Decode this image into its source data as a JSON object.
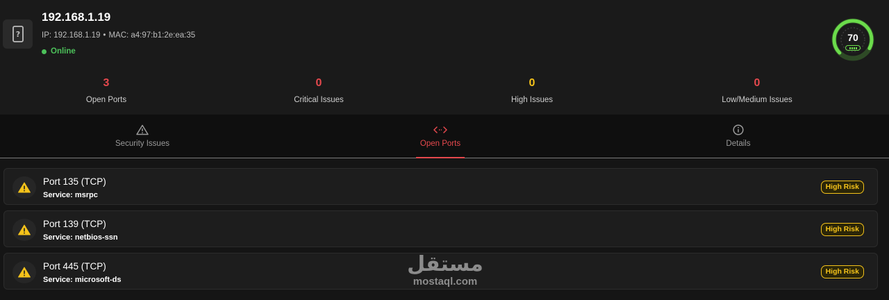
{
  "device": {
    "title": "192.168.1.19",
    "ip_line": "IP: 192.168.1.19",
    "separator": "•",
    "mac_line": "MAC: a4:97:b1:2e:ea:35",
    "status": "Online",
    "score": "70",
    "icon": "unknown-device-icon"
  },
  "stats": [
    {
      "value": "3",
      "label": "Open Ports",
      "color": "#e5484d"
    },
    {
      "value": "0",
      "label": "Critical Issues",
      "color": "#e5484d"
    },
    {
      "value": "0",
      "label": "High Issues",
      "color": "#f4c21a"
    },
    {
      "value": "0",
      "label": "Low/Medium Issues",
      "color": "#e5484d"
    }
  ],
  "tabs": [
    {
      "label": "Security Issues",
      "icon": "warning-triangle-icon"
    },
    {
      "label": "Open Ports",
      "icon": "code-arrows-icon",
      "active": true
    },
    {
      "label": "Details",
      "icon": "info-circle-icon"
    }
  ],
  "ports": [
    {
      "title": "Port 135 (TCP)",
      "service": "Service: msrpc",
      "risk": "High Risk"
    },
    {
      "title": "Port 139 (TCP)",
      "service": "Service: netbios-ssn",
      "risk": "High Risk"
    },
    {
      "title": "Port 445 (TCP)",
      "service": "Service: microsoft-ds",
      "risk": "High Risk"
    }
  ],
  "watermark": {
    "arabic": "مستقل",
    "latin": "mostaql.com"
  },
  "colors": {
    "accent": "#e5484d",
    "warning": "#f4c21a",
    "online": "#4cc15a",
    "score": "#6bdc4b"
  }
}
